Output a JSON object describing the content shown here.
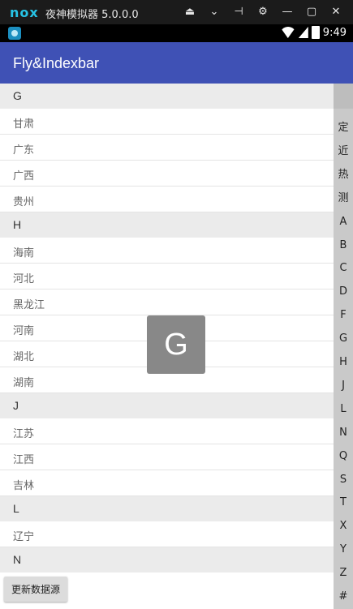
{
  "emulator": {
    "logo": "nox",
    "title": "夜神模拟器 5.0.0.0",
    "controls": [
      "⏏",
      "⌄",
      "⊣",
      "⚙",
      "—",
      "▢",
      "✕"
    ]
  },
  "status_bar": {
    "time": "9:49"
  },
  "toolbar": {
    "title": "Fly&Indexbar"
  },
  "list": [
    {
      "type": "header",
      "text": "G"
    },
    {
      "type": "item",
      "text": "甘肃"
    },
    {
      "type": "item",
      "text": "广东"
    },
    {
      "type": "item",
      "text": "广西"
    },
    {
      "type": "item",
      "text": "贵州"
    },
    {
      "type": "header",
      "text": "H"
    },
    {
      "type": "item",
      "text": "海南"
    },
    {
      "type": "item",
      "text": "河北"
    },
    {
      "type": "item",
      "text": "黑龙江"
    },
    {
      "type": "item",
      "text": "河南"
    },
    {
      "type": "item",
      "text": "湖北"
    },
    {
      "type": "item",
      "text": "湖南"
    },
    {
      "type": "header",
      "text": "J"
    },
    {
      "type": "item",
      "text": "江苏"
    },
    {
      "type": "item",
      "text": "江西"
    },
    {
      "type": "item",
      "text": "吉林"
    },
    {
      "type": "header",
      "text": "L"
    },
    {
      "type": "item",
      "text": "辽宁"
    },
    {
      "type": "header",
      "text": "N"
    }
  ],
  "index_bar": [
    "定",
    "近",
    "热",
    "测",
    "A",
    "B",
    "C",
    "D",
    "F",
    "G",
    "H",
    "J",
    "L",
    "N",
    "Q",
    "S",
    "T",
    "X",
    "Y",
    "Z",
    "#"
  ],
  "overlay_letter": "G",
  "refresh_button": "更新数据源",
  "colors": {
    "toolbar": "#3f51b5",
    "index_bar": "#c9c9c9",
    "header_row": "#ebebeb",
    "overlay": "#888888"
  }
}
